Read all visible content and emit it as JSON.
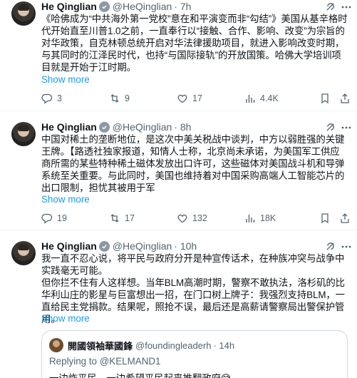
{
  "tweets": [
    {
      "author": "He Qinglian",
      "handle": "@HeQinglian",
      "time": "· 7h",
      "text": "《哈佛成为“中共海外第一党校”意在和平演变而非“勾结”》美国从基辛格时代开始直至川普1.0之前，一直奉行以“接触、合作、影响、改变”为宗旨的对华政策，自克林顿总统开启对华法律援助项目，就进入影响改变时期，与其同时的江泽民时代，也持“与国际接轨”的开放国策。哈佛大学培训项目就是开始于江时期。",
      "show_more": "Show more",
      "replies": "3",
      "reposts": "9",
      "likes": "17",
      "views": "4.4K"
    },
    {
      "author": "He Qinglian",
      "handle": "@HeQinglian",
      "time": "· 8h",
      "text": "中国对稀土的垄断地位，是这次中美关税战中谈判，中方以弱胜强的关键王牌。【路透社独家报道，知情人士称，北京尚未承诺，为美国军工供应商所需的某些特种稀土磁体发放出口许可，这些磁体对美国战斗机和导弹系统至关重要。与此同时，美国也维持着对中国采购高端人工智能芯片的出口限制，担忧其被用于军",
      "show_more": "Show more",
      "replies": "19",
      "reposts": "17",
      "likes": "132",
      "views": "18K"
    },
    {
      "author": "He Qinglian",
      "handle": "@HeQinglian",
      "time": "· 10h",
      "text": "我一直不忍心说，将平民与政府分开是种宣传话术，在种族冲突与战争中实践毫无可能。\n但你拦不住有人这样想。当年BLM高潮时期，警察不敢执法，洛杉矶的比华利山庄的影星与巨富想出一招，在门口树上牌子：我强烈支持BLM，一直给民主党捐款。结果呢，照抢不误，最后还是高薪请警察局出警保护管用。",
      "show_more": "Show more"
    }
  ],
  "quote": {
    "author": "開國領袖華國鋒",
    "handle": "@foundingleaderh",
    "time": "· 14h",
    "replying_to": "Replying to @KELMAND1",
    "text": "一边炸平民，一边希望平民起来推翻政府😅"
  },
  "icons": {
    "reply": "reply-icon",
    "repost": "repost-icon",
    "like": "heart-icon",
    "views": "views-icon",
    "bookmark": "bookmark-icon",
    "share": "share-icon",
    "grok": "grok-icon",
    "more": "more-icon"
  },
  "colors": {
    "link": "#1d9bf0",
    "muted": "#536471",
    "text": "#0f1419",
    "badge": "#8b98a5",
    "divider": "#eff3f4"
  }
}
